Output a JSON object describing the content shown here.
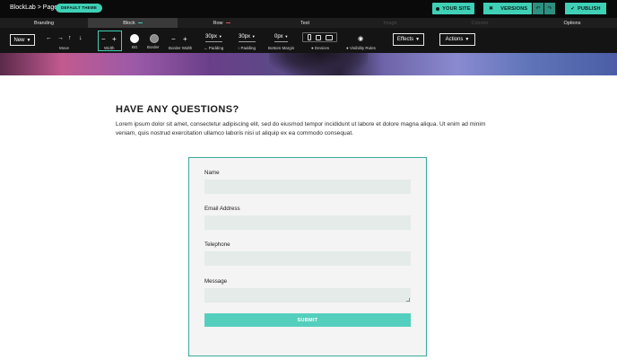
{
  "topbar": {
    "breadcrumb": "BlockLab > Page",
    "theme_badge": "DEFAULT THEME",
    "your_site": "YOUR SITE",
    "versions": "VERSIONS",
    "publish": "PUBLISH"
  },
  "tabs": [
    {
      "label": "Branding",
      "state": "normal"
    },
    {
      "label": "Block",
      "state": "active",
      "mark_color": "#3fd0b6"
    },
    {
      "label": "Row",
      "state": "normal",
      "mark_color": "#e0556a"
    },
    {
      "label": "Text",
      "state": "normal"
    },
    {
      "label": "Image",
      "state": "disabled"
    },
    {
      "label": "Column",
      "state": "disabled"
    },
    {
      "label": "Options",
      "state": "normal"
    }
  ],
  "toolbar": {
    "new_label": "New",
    "move_label": "Move",
    "width_label": "Width",
    "bg_label": "BG",
    "border_label": "Border",
    "border_width_label": "Border Width",
    "padding_value": "30px",
    "padding_label": "Padding",
    "tpadding_value": "30px",
    "tpadding_label": "Padding",
    "margin_value": "0px",
    "margin_label": "Bottom Margin",
    "devices_label": "Devices",
    "visibility_label": "Visibility Rules",
    "effects_label": "Effects",
    "actions_label": "Actions"
  },
  "content": {
    "heading": "HAVE ANY QUESTIONS?",
    "intro": "Lorem ipsum dolor sit amet, consectetur adipiscing elit, sed do eiusmod tempor incididunt ut labore et dolore magna aliqua. Ut enim ad minim veniam, quis nostrud exercitation ullamco laboris nisi ut aliquip ex ea commodo consequat."
  },
  "form": {
    "fields": [
      {
        "label": "Name",
        "value": ""
      },
      {
        "label": "Email Address",
        "value": ""
      },
      {
        "label": "Telephone",
        "value": ""
      },
      {
        "label": "Message",
        "value": ""
      }
    ],
    "submit": "SUBMIT"
  },
  "colors": {
    "accent": "#3fd0b6",
    "form_border": "#3aa99a",
    "submit_bg": "#55cfbd",
    "toolbar_bg": "#141414"
  }
}
